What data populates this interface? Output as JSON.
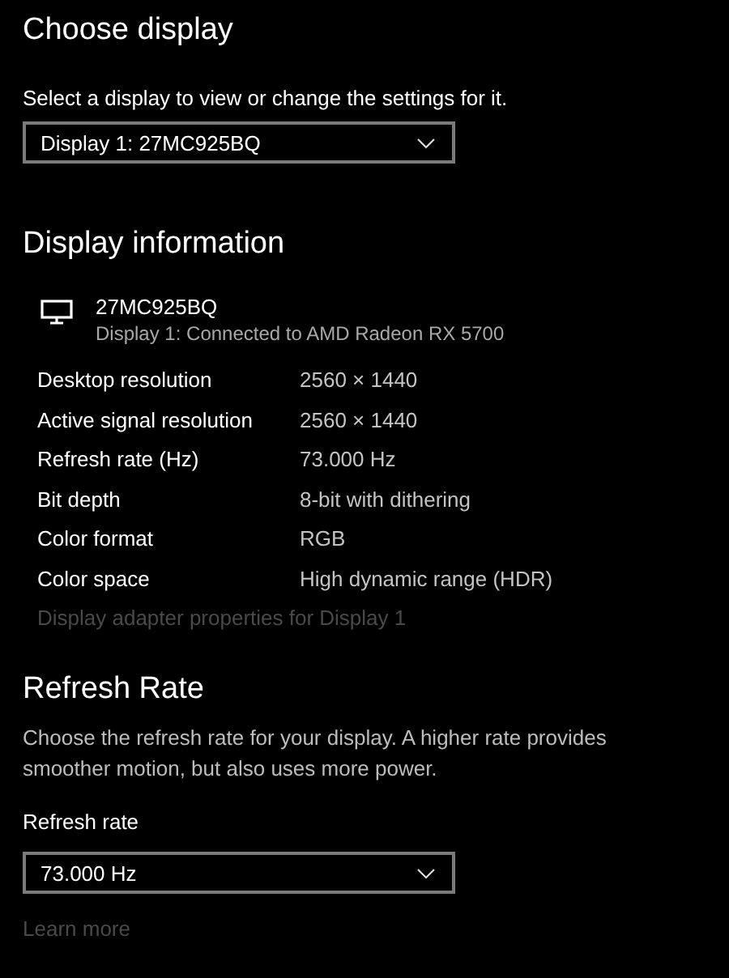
{
  "choose_display": {
    "title": "Choose display",
    "description": "Select a display to view or change the settings for it.",
    "dropdown": {
      "value": "Display 1: 27MC925BQ"
    }
  },
  "display_information": {
    "title": "Display information",
    "monitor": {
      "name": "27MC925BQ",
      "connection": "Display 1: Connected to AMD Radeon RX 5700"
    },
    "rows": [
      {
        "label": "Desktop resolution",
        "value": "2560 × 1440"
      },
      {
        "label": "Active signal resolution",
        "value": "2560 × 1440"
      },
      {
        "label": "Refresh rate (Hz)",
        "value": "73.000 Hz"
      },
      {
        "label": "Bit depth",
        "value": "8-bit with dithering"
      },
      {
        "label": "Color format",
        "value": "RGB"
      },
      {
        "label": "Color space",
        "value": "High dynamic range (HDR)"
      }
    ],
    "link": {
      "text": "Display adapter properties for Display 1",
      "disabled": true
    }
  },
  "refresh_rate": {
    "title": "Refresh Rate",
    "description": "Choose the refresh rate for your display. A higher rate provides smoother motion, but also uses more power.",
    "field_label": "Refresh rate",
    "dropdown": {
      "value": "73.000 Hz"
    },
    "link": {
      "text": "Learn more",
      "disabled": true
    }
  }
}
